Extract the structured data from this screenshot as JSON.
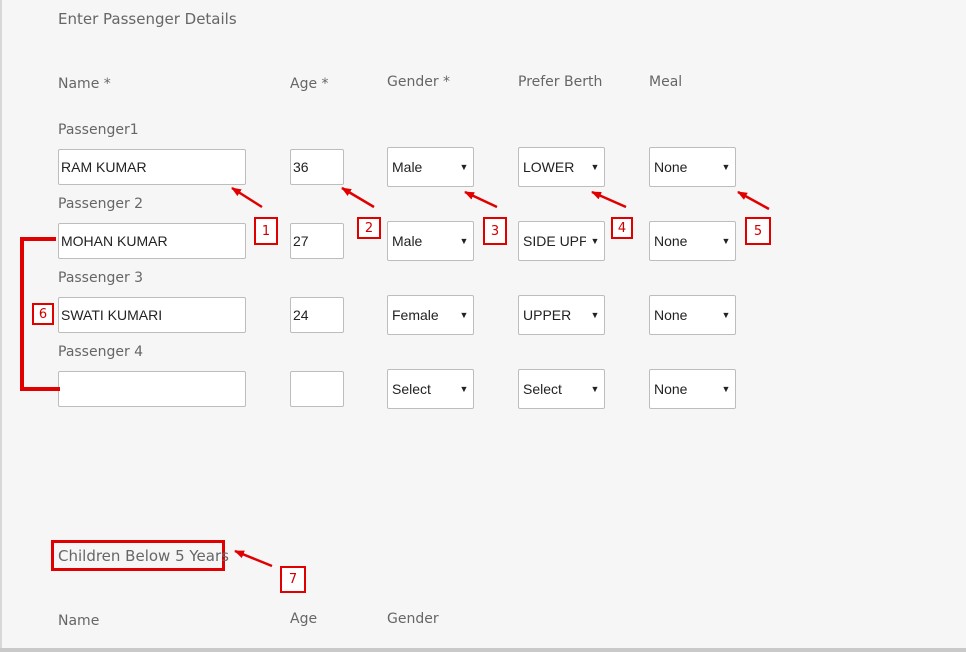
{
  "section_title": "Enter Passenger Details",
  "headers": {
    "name": "Name *",
    "age": "Age *",
    "gender": "Gender *",
    "berth": "Prefer Berth",
    "meal": "Meal"
  },
  "passengers": [
    {
      "label": "Passenger1",
      "name": "RAM KUMAR",
      "age": "36",
      "gender": "Male",
      "berth": "LOWER",
      "meal": "None"
    },
    {
      "label": "Passenger 2",
      "name": "MOHAN KUMAR",
      "age": "27",
      "gender": "Male",
      "berth": "SIDE UPPER",
      "meal": "None"
    },
    {
      "label": "Passenger 3",
      "name": "SWATI KUMARI",
      "age": "24",
      "gender": "Female",
      "berth": "UPPER",
      "meal": "None"
    },
    {
      "label": "Passenger 4",
      "name": "",
      "age": "",
      "gender": "Select",
      "berth": "Select",
      "meal": "None"
    }
  ],
  "children": {
    "title": "Children Below 5 Years",
    "headers": {
      "name": "Name",
      "age": "Age",
      "gender": "Gender"
    }
  },
  "annotations": [
    "1",
    "2",
    "3",
    "4",
    "5",
    "6",
    "7"
  ],
  "colors": {
    "annotation": "#e00000",
    "background": "#f6f6f6",
    "field_border": "#bdbdbd"
  }
}
